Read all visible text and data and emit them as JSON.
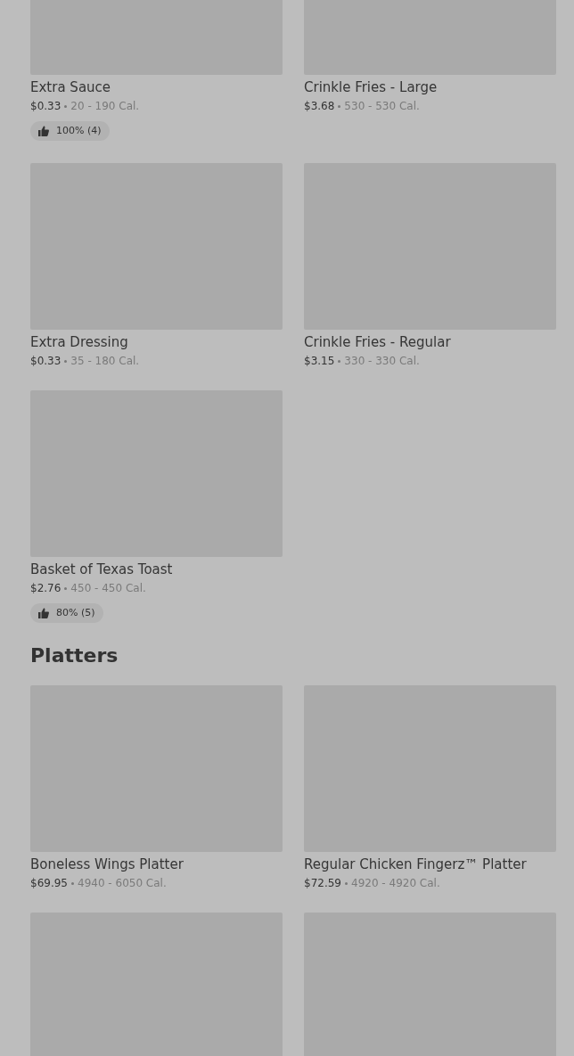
{
  "sections": [
    {
      "items": [
        {
          "kind": "product",
          "name": "Extra Sauce",
          "price": "$0.33",
          "calories": "20 - 190 Cal.",
          "rating": "100% (4)"
        },
        {
          "kind": "product",
          "name": "Crinkle Fries - Large",
          "price": "$3.68",
          "calories": "530 - 530 Cal."
        },
        {
          "kind": "product",
          "name": "Extra Dressing",
          "price": "$0.33",
          "calories": "35 - 180 Cal."
        },
        {
          "kind": "product",
          "name": "Crinkle Fries - Regular",
          "price": "$3.15",
          "calories": "330 - 330 Cal."
        },
        {
          "kind": "product",
          "name": "Basket of Texas Toast",
          "price": "$2.76",
          "calories": "450 - 450 Cal.",
          "rating": "80% (5)"
        }
      ]
    },
    {
      "title": "Platters",
      "items": [
        {
          "kind": "product",
          "name": "Boneless Wings Platter",
          "price": "$69.95",
          "calories": "4940 - 6050 Cal."
        },
        {
          "kind": "product",
          "name": "Regular Chicken Fingerz™ Platter",
          "price": "$72.59",
          "calories": "4920 - 4920 Cal."
        },
        {
          "kind": "image-only"
        },
        {
          "kind": "image-only"
        }
      ]
    }
  ]
}
